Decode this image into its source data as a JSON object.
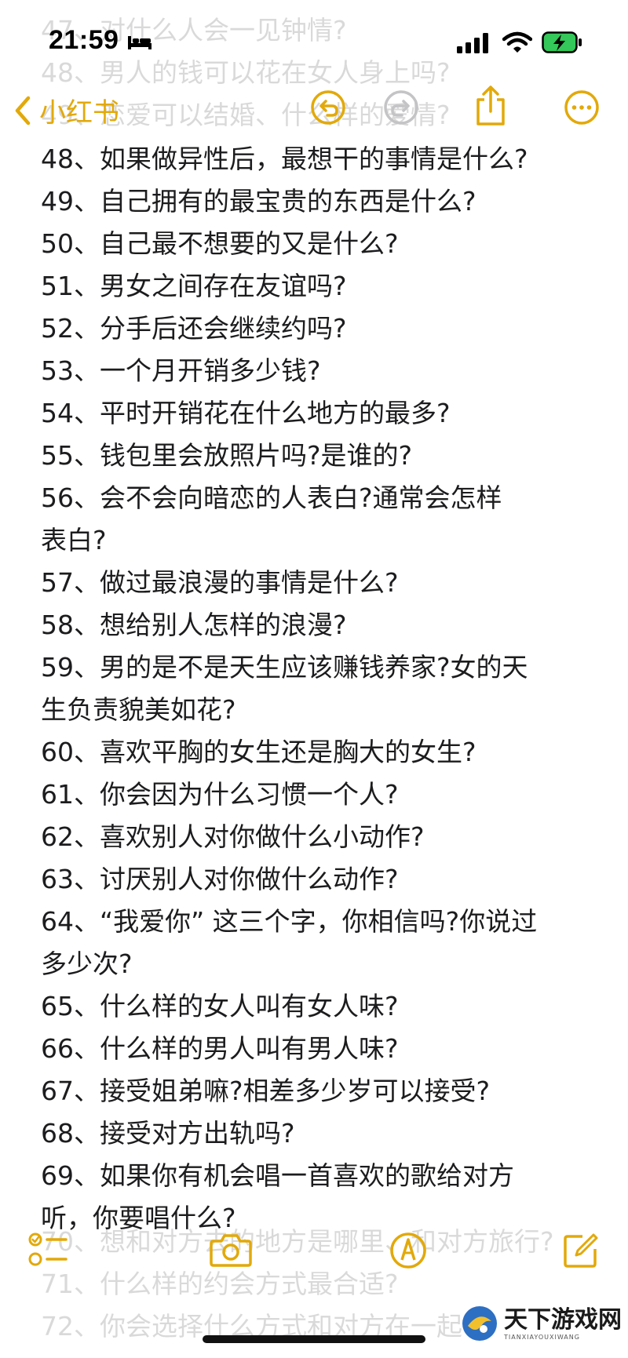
{
  "status_bar": {
    "time": "21:59"
  },
  "nav": {
    "back_label": "小红书",
    "accent_color": "#E2A90A",
    "icons": [
      "undo-icon",
      "redo-icon",
      "share-icon",
      "more-icon"
    ]
  },
  "ghost_top": [
    "47、对什么人会一见钟情?",
    "48、男人的钱可以花在女人身上吗?",
    "49、恋爱可以结婚、什么样的爱情?"
  ],
  "items": [
    "48、如果做异性后，最想干的事情是什么?",
    "49、自己拥有的最宝贵的东西是什么?",
    "50、自己最不想要的又是什么?",
    "51、男女之间存在友谊吗?",
    "52、分手后还会继续约吗?",
    "53、一个月开销多少钱?",
    "54、平时开销花在什么地方的最多?",
    "55、钱包里会放照片吗?是谁的?",
    "56、会不会向暗恋的人表白?通常会怎样",
    "表白?",
    "57、做过最浪漫的事情是什么?",
    "58、想给别人怎样的浪漫?",
    "59、男的是不是天生应该赚钱养家?女的天",
    "生负责貌美如花?",
    "60、喜欢平胸的女生还是胸大的女生?",
    "61、你会因为什么习惯一个人?",
    "62、喜欢别人对你做什么小动作?",
    "63、讨厌别人对你做什么动作?",
    "64、“我爱你” 这三个字，你相信吗?你说过",
    "多少次?",
    "65、什么样的女人叫有女人味?",
    "66、什么样的男人叫有男人味?",
    "67、接受姐弟嘛?相差多少岁可以接受?",
    "68、接受对方出轨吗?",
    "69、如果你有机会唱一首喜欢的歌给对方",
    "听，你要唱什么?"
  ],
  "ghost_bottom": [
    "70、想和对方去的地方是哪里、和对方旅行?",
    "71、什么样的约会方式最合适?",
    "72、你会选择什么方式和对方在一起?"
  ],
  "toolbar": {
    "icons": [
      "checklist-icon",
      "camera-icon",
      "markup-icon",
      "compose-icon"
    ]
  },
  "watermark": {
    "title": "天下游戏网",
    "subtitle": "TIANXIAYOUXIWANG"
  }
}
